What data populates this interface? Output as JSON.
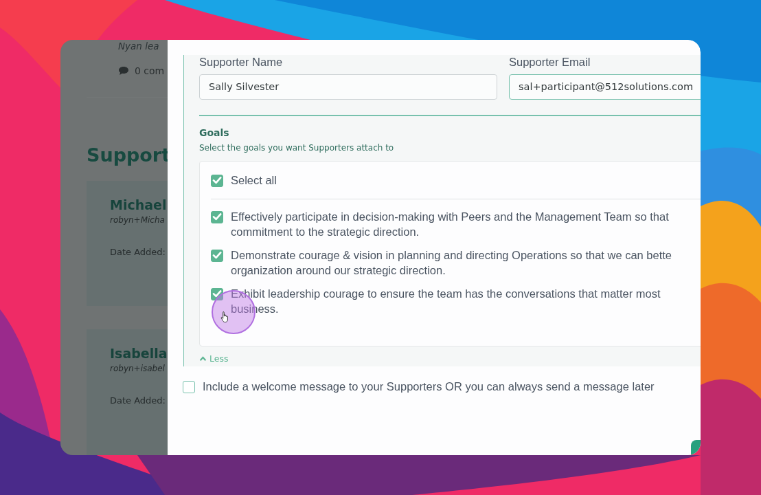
{
  "backdrop": {
    "post_excerpt": "Nyan lea",
    "comments": "0 com",
    "heading": "Support",
    "supporters": [
      {
        "name": "Michael",
        "email": "robyn+Micha",
        "date_label": "Date Added:"
      },
      {
        "name": "Isabella",
        "email": "robyn+isabel",
        "date_label": "Date Added:"
      }
    ]
  },
  "modal": {
    "fields": [
      {
        "label": "Supporter Name",
        "value": "Sally Silvester",
        "focused": false
      },
      {
        "label": "Supporter Email",
        "value": "sal+participant@512solutions.com",
        "focused": true
      }
    ],
    "goals": {
      "title": "Goals",
      "subtitle": "Select the goals you want Supporters attach to",
      "select_all": {
        "label": "Select all",
        "checked": true
      },
      "items": [
        {
          "lines": [
            "Effectively participate in decision-making with Peers and the Management Team so that",
            "commitment to the strategic direction."
          ],
          "checked": true
        },
        {
          "lines": [
            "Demonstrate courage & vision in planning and directing Operations so that we can bette",
            "organization around our strategic direction."
          ],
          "checked": true
        },
        {
          "lines": [
            "Exhibit leadership courage to ensure the team has the conversations that matter most",
            "business."
          ],
          "checked": true
        }
      ],
      "toggle": "Less"
    },
    "welcome_message": {
      "label": "Include a welcome message to your Supporters OR you can always send a message later",
      "checked": false
    }
  }
}
